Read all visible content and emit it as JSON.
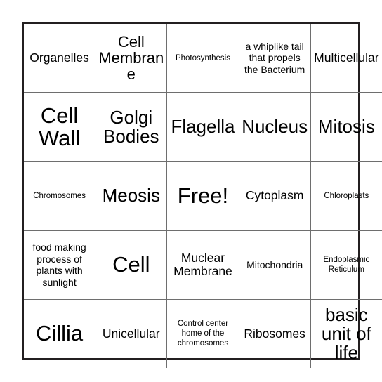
{
  "card": {
    "type": "bingo-card",
    "columns": 5,
    "rows": 5,
    "free_space": {
      "row": 2,
      "col": 2,
      "label": "Free!"
    },
    "border_color": "#231f20",
    "gridline_color": "#6e6e6e",
    "text_color": "#000000",
    "background_color": "#ffffff",
    "cells": [
      [
        {
          "text": "Organelles",
          "size": "md"
        },
        {
          "text": "Cell Membrane",
          "size": "lg"
        },
        {
          "text": "Photosynthesis",
          "size": "xs"
        },
        {
          "text": "a whiplike tail that propels the Bacterium",
          "size": "sm"
        },
        {
          "text": "Multicellular",
          "size": "md"
        }
      ],
      [
        {
          "text": "Cell Wall",
          "size": "xxl"
        },
        {
          "text": "Golgi Bodies",
          "size": "xl"
        },
        {
          "text": "Flagella",
          "size": "xl"
        },
        {
          "text": "Nucleus",
          "size": "xl"
        },
        {
          "text": "Mitosis",
          "size": "xl"
        }
      ],
      [
        {
          "text": "Chromosomes",
          "size": "xs"
        },
        {
          "text": "Meosis",
          "size": "xl"
        },
        {
          "text": "Free!",
          "size": "xxl"
        },
        {
          "text": "Cytoplasm",
          "size": "md"
        },
        {
          "text": "Chloroplasts",
          "size": "xs"
        }
      ],
      [
        {
          "text": "food making process of plants with sunlight",
          "size": "sm"
        },
        {
          "text": "Cell",
          "size": "xxl"
        },
        {
          "text": "Muclear Membrane",
          "size": "md"
        },
        {
          "text": "Mitochondria",
          "size": "sm"
        },
        {
          "text": "Endoplasmic Reticulum",
          "size": "xs"
        }
      ],
      [
        {
          "text": "Cillia",
          "size": "xxl"
        },
        {
          "text": "Unicellular",
          "size": "md"
        },
        {
          "text": "Control center home of the chromosomes",
          "size": "xs"
        },
        {
          "text": "Ribosomes",
          "size": "md"
        },
        {
          "text": "basic unit of life",
          "size": "xl"
        }
      ]
    ]
  }
}
